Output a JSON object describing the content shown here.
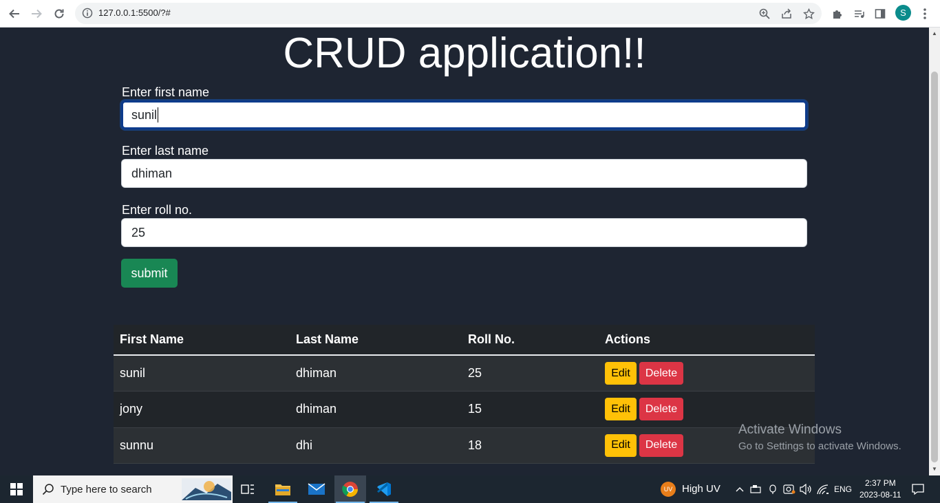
{
  "browser": {
    "url": "127.0.0.1:5500/?#",
    "profile_initial": "S"
  },
  "page": {
    "title": "CRUD application!!",
    "fields": [
      {
        "label": "Enter first name",
        "value": "sunil"
      },
      {
        "label": "Enter last name",
        "value": "dhiman"
      },
      {
        "label": "Enter roll no.",
        "value": "25"
      }
    ],
    "submit_label": "submit"
  },
  "table": {
    "headers": [
      "First Name",
      "Last Name",
      "Roll No.",
      "Actions"
    ],
    "rows": [
      {
        "first": "sunil",
        "last": "dhiman",
        "roll": "25"
      },
      {
        "first": "jony",
        "last": "dhiman",
        "roll": "15"
      },
      {
        "first": "sunnu",
        "last": "dhi",
        "roll": "18"
      }
    ],
    "edit_label": "Edit",
    "delete_label": "Delete"
  },
  "watermark": {
    "line1": "Activate Windows",
    "line2": "Go to Settings to activate Windows."
  },
  "taskbar": {
    "search_placeholder": "Type here to search",
    "weather_badge": "UV",
    "weather_text": "High UV",
    "language": "ENG",
    "time": "2:37 PM",
    "date": "2023-08-11"
  },
  "colors": {
    "page_bg": "#1e2532",
    "submit": "#198754",
    "edit": "#ffc107",
    "delete": "#dc3545",
    "focus_border": "#0d3b8c"
  }
}
